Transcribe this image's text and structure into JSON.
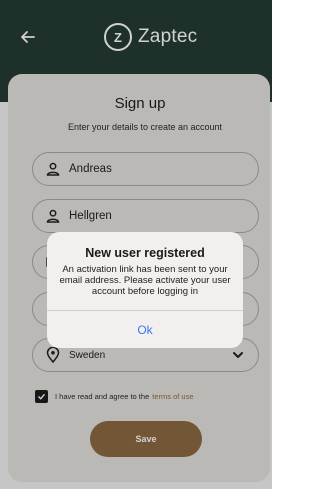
{
  "header": {
    "brand_name": "Zaptec",
    "logo_letter": "Z"
  },
  "signup": {
    "title": "Sign up",
    "subtitle": "Enter your details to create an account",
    "first_name": "Andreas",
    "last_name": "Hellgren",
    "country": "Sweden",
    "terms_text": "I have read and agree to the",
    "terms_link": "terms of use",
    "terms_checked": true,
    "save_label": "Save"
  },
  "dialog": {
    "title": "New user registered",
    "message": "An activation link has been sent to your email address. Please activate your user account before logging in",
    "ok_label": "Ok"
  },
  "colors": {
    "header_bg": "#243b33",
    "accent": "#8b6a43",
    "link": "#3a78f2"
  }
}
